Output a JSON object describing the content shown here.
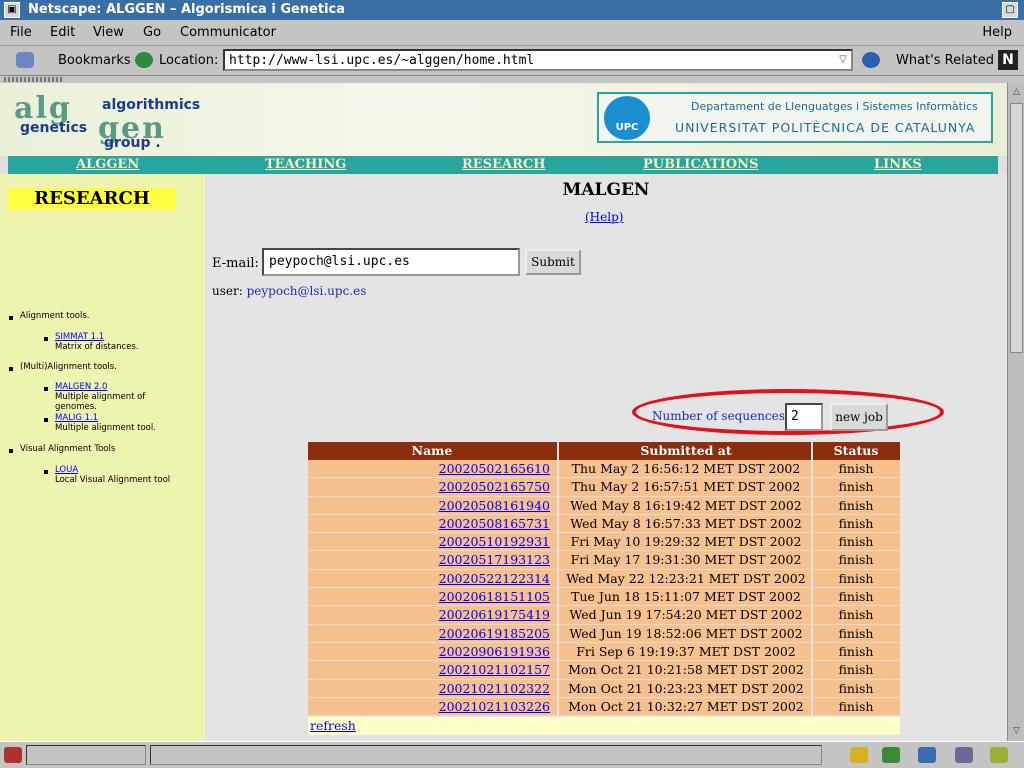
{
  "window": {
    "title": "Netscape: ALGGEN – Algorismica i Genetica"
  },
  "menu": {
    "file": "File",
    "edit": "Edit",
    "view": "View",
    "go": "Go",
    "communicator": "Communicator",
    "help": "Help"
  },
  "location_bar": {
    "bookmarks": "Bookmarks",
    "location_label": "Location:",
    "url": "http://www-lsi.upc.es/~alggen/home.html",
    "whats_related": "What's Related",
    "brand_letter": "N"
  },
  "banner": {
    "logo_big_1": "alg",
    "logo_big_2": "gen",
    "logo_algorithmics": "algorithmics",
    "logo_genetics": "genetics",
    "logo_group": "group .",
    "upc_seal": "UPC",
    "upc_dept": "Departament de Llenguatges i Sistemes Informàtics",
    "upc_univ": "UNIVERSITAT POLITÈCNICA DE CATALUNYA"
  },
  "nav": {
    "alggen": "ALGGEN",
    "teaching": "TEACHING",
    "research": "RESEARCH",
    "publications": "PUBLICATIONS",
    "links": "LINKS"
  },
  "sidebar": {
    "title": "RESEARCH",
    "s1": "Alignment tools.",
    "simmat": "SIMMAT 1.1",
    "simmat_desc": "Matrix of distances.",
    "s2": "(Multi)Alignment tools.",
    "malgen": "MALGEN 2.0",
    "malgen_desc1": "Multiple alignment of",
    "malgen_desc2": "genomes.",
    "malig": "MALIG 1.1",
    "malig_desc": "Multiple alignment tool.",
    "s3": "Visual Alignment Tools",
    "loua": "LOUA",
    "loua_desc": "Local Visual Alignment tool"
  },
  "main": {
    "title": "MALGEN",
    "help": "(Help)",
    "email_label": "E-mail:",
    "email_value": "peypoch@lsi.upc.es",
    "submit": "Submit",
    "user_label": "user:",
    "user_email": "peypoch@lsi.upc.es",
    "nseq_label": "Number of sequences:",
    "nseq_value": "2",
    "new_job": "new job",
    "highlight_color": "#e0121b"
  },
  "jobs": {
    "headers": {
      "name": "Name",
      "submitted": "Submitted at",
      "status": "Status"
    },
    "rows": [
      {
        "name": "20020502165610",
        "submitted": "Thu May 2 16:56:12 MET DST 2002",
        "status": "finish"
      },
      {
        "name": "20020502165750",
        "submitted": "Thu May 2 16:57:51 MET DST 2002",
        "status": "finish"
      },
      {
        "name": "20020508161940",
        "submitted": "Wed May 8 16:19:42 MET DST 2002",
        "status": "finish"
      },
      {
        "name": "20020508165731",
        "submitted": "Wed May 8 16:57:33 MET DST 2002",
        "status": "finish"
      },
      {
        "name": "20020510192931",
        "submitted": "Fri May 10 19:29:32 MET DST 2002",
        "status": "finish"
      },
      {
        "name": "20020517193123",
        "submitted": "Fri May 17 19:31:30 MET DST 2002",
        "status": "finish"
      },
      {
        "name": "20020522122314",
        "submitted": "Wed May 22 12:23:21 MET DST 2002",
        "status": "finish"
      },
      {
        "name": "20020618151105",
        "submitted": "Tue Jun 18 15:11:07 MET DST 2002",
        "status": "finish"
      },
      {
        "name": "20020619175419",
        "submitted": "Wed Jun 19 17:54:20 MET DST 2002",
        "status": "finish"
      },
      {
        "name": "20020619185205",
        "submitted": "Wed Jun 19 18:52:06 MET DST 2002",
        "status": "finish"
      },
      {
        "name": "20020906191936",
        "submitted": "Fri Sep 6 19:19:37 MET DST 2002",
        "status": "finish"
      },
      {
        "name": "20021021102157",
        "submitted": "Mon Oct 21 10:21:58 MET DST 2002",
        "status": "finish"
      },
      {
        "name": "20021021102322",
        "submitted": "Mon Oct 21 10:23:23 MET DST 2002",
        "status": "finish"
      },
      {
        "name": "20021021103226",
        "submitted": "Mon Oct 21 10:32:27 MET DST 2002",
        "status": "finish"
      }
    ],
    "refresh": "refresh"
  }
}
